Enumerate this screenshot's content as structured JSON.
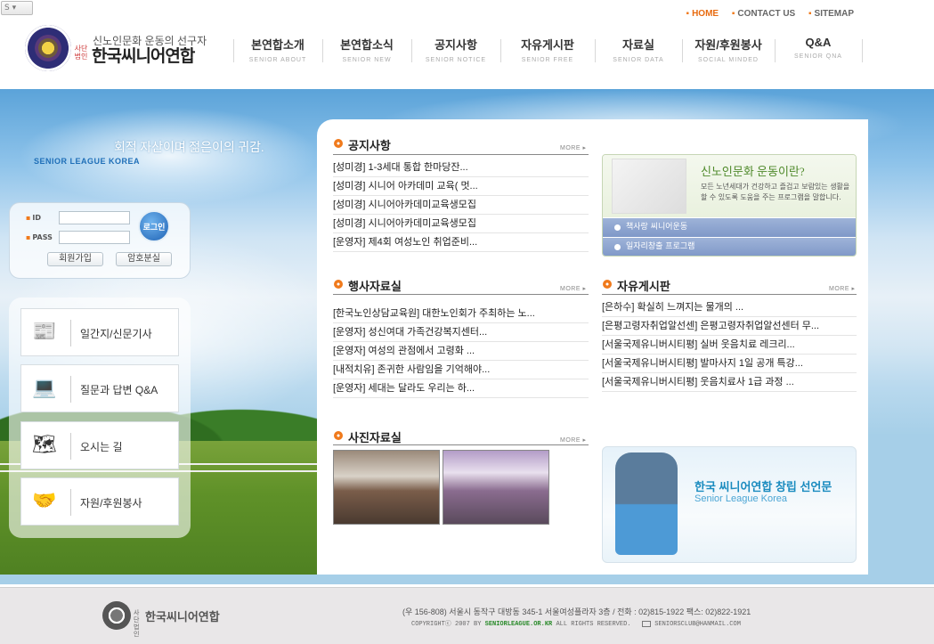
{
  "top_nav": {
    "home": "HOME",
    "contact": "CONTACT US",
    "sitemap": "SITEMAP"
  },
  "brand": {
    "subtitle": "신노인문화 운동의 선구자",
    "org_type": "사단법인",
    "name": "한국씨니어연합"
  },
  "gnb": [
    {
      "ko": "본연합소개",
      "en": "SENIOR ABOUT"
    },
    {
      "ko": "본연합소식",
      "en": "SENIOR NEW"
    },
    {
      "ko": "공지사항",
      "en": "SENIOR NOTICE"
    },
    {
      "ko": "자유게시판",
      "en": "SENIOR FREE"
    },
    {
      "ko": "자료실",
      "en": "SENIOR DATA"
    },
    {
      "ko": "자원/후원봉사",
      "en": "SOCIAL MINDED"
    },
    {
      "ko": "Q&A",
      "en": "SENIOR QNA"
    }
  ],
  "hero": {
    "slogan": "회적 자산이며 젊은이의 귀감.",
    "league": "SENIOR LEAGUE KOREA"
  },
  "login": {
    "id_label": "ID",
    "pass_label": "PASS",
    "login_button": "로그인",
    "join_button": "회원가입",
    "find_pw_button": "암호분실"
  },
  "quick_menu": [
    {
      "label": "일간지/신문기사",
      "icon": "newspaper-icon"
    },
    {
      "label": "질문과 답변 Q&A",
      "icon": "question-computer-icon"
    },
    {
      "label": "오시는 길",
      "icon": "map-icon"
    },
    {
      "label": "자원/후원봉사",
      "icon": "volunteer-icon"
    }
  ],
  "notice": {
    "title": "공지사항",
    "more": "MORE",
    "items": [
      "[성미경] 1-3세대 통합 한마당잔...",
      "[성미경] 시니어 아카데미 교육( 멋...",
      "[성미경] 시니어아카데미교육생모집",
      "[성미경] 시니어아카데미교육생모집",
      "[운영자] 제4회 여성노인 취업준비..."
    ]
  },
  "movement": {
    "title": "신노인문화 운동이란?",
    "desc": "모든 노년세대가 건강하고 즐겁고 보람있는 생활을 할 수 있도록 도움을 주는 프로그램을 말합니다.",
    "links": [
      "책사랑 씨니어운동",
      "일자리창출 프로그램"
    ]
  },
  "event_archive": {
    "title": "행사자료실",
    "more": "MORE",
    "items": [
      "[한국노인상담교육원] 대한노인회가 주최하는 노...",
      "[운영자] 성신여대 가족건강복지센터...",
      "[운영자] 여성의 관점에서 고령화 ...",
      "[내적치유] 존귀한 사람임을 기억해야...",
      "[운영자] 세대는 달라도 우리는 하..."
    ]
  },
  "free_board": {
    "title": "자유게시판",
    "more": "MORE",
    "items": [
      "[은하수] 확실히 느껴지는 물개의 ...",
      "[은평고령자취업알선센] 은평고령자취업알선센터 무...",
      "[서울국제유니버시티평] 실버 웃음치료 레크리...",
      "[서울국제유니버시티평] 발마사지 1일 공개 특강...",
      "[서울국제유니버시티평] 웃음치료사 1급 과정 ..."
    ]
  },
  "photo_archive": {
    "title": "사진자료실",
    "more": "MORE"
  },
  "declaration": {
    "title": "한국 씨니어연합 창립 선언문",
    "subtitle": "Senior League Korea"
  },
  "footer": {
    "org_type": "사단법인",
    "name": "한국씨니어연합",
    "address": "(우 156-808) 서울시 동작구 대방동 345-1 서울여성플라자 3층 / 전화 : 02)815-1922  팩스: 02)822-1921",
    "copyright_prefix": "COPYRIGHTⓒ 2007 BY",
    "copyright_site": "SENIORLEAGUE.OR.KR",
    "copyright_suffix": "ALL RIGHTS RESERVED.",
    "email": "SENIORSCLUB@HANMAIL.COM"
  },
  "colors": {
    "accent": "#f07a1c",
    "brand_blue": "#1f63b5",
    "green": "#4f8a2b"
  }
}
